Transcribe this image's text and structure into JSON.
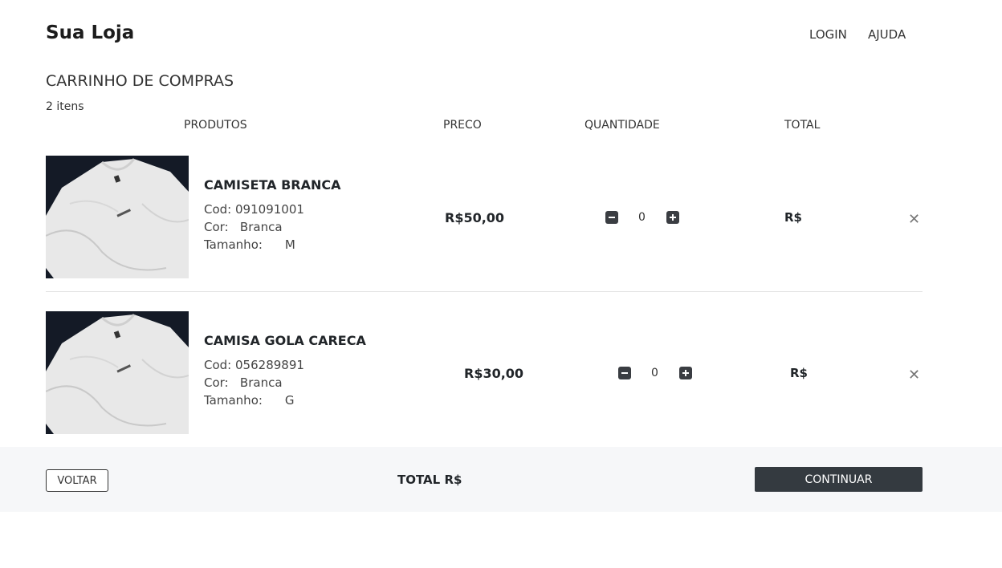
{
  "header": {
    "brand": "Sua Loja",
    "nav": {
      "login": "LOGIN",
      "help": "AJUDA"
    }
  },
  "cart": {
    "title": "CARRINHO DE COMPRAS",
    "count": "2 itens",
    "columns": {
      "products": "PRODUTOS",
      "price": "PRECO",
      "quantity": "QUANTIDADE",
      "total": "TOTAL"
    },
    "labels": {
      "code": "Cod:",
      "color": "Cor:",
      "size": "Tamanho:"
    },
    "items": [
      {
        "name": "CAMISETA BRANCA",
        "code": "091091001",
        "color": "Branca",
        "size": "M",
        "price": "R$50,00",
        "quantity": "0",
        "total": "R$",
        "remove": "✕",
        "image": "white-tshirt-photo"
      },
      {
        "name": "CAMISA GOLA CARECA",
        "code": "056289891",
        "color": "Branca",
        "size": "G",
        "price": "R$30,00",
        "quantity": "0",
        "total": "R$",
        "remove": "✕",
        "image": "white-tshirt-photo"
      }
    ]
  },
  "footer": {
    "back_label": "VOLTAR",
    "total_label": "TOTAL R$",
    "continue_label": "CONTINUAR"
  },
  "colors": {
    "primary_dark": "#343a40",
    "footer_bg": "#f6f7f9",
    "text": "#212529"
  }
}
